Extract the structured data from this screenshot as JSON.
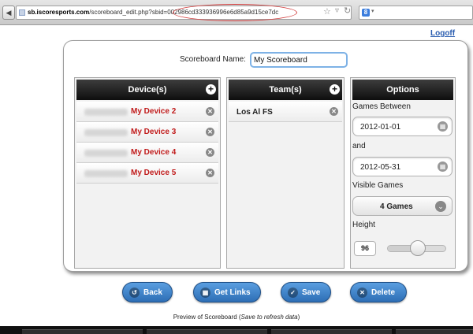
{
  "browser": {
    "url_domain": "sb.iscoresports.com",
    "url_path": "/scoreboard_edit.php?sbid=",
    "url_sbid": "002986cd333936996e6d85a9d15ce7dc",
    "search_engine_letter": "8"
  },
  "header": {
    "logoff_label": "Logoff"
  },
  "scoreboard": {
    "name_label": "Scoreboard Name:",
    "name_value": "My Scoreboard"
  },
  "devices": {
    "title": "Device(s)",
    "items": [
      {
        "label": "My Device 2"
      },
      {
        "label": "My Device 3"
      },
      {
        "label": "My Device 4"
      },
      {
        "label": "My Device 5"
      }
    ]
  },
  "teams": {
    "title": "Team(s)",
    "items": [
      {
        "label": "Los Al FS"
      }
    ]
  },
  "options": {
    "title": "Options",
    "games_between_label": "Games Between",
    "start_date": "2012-01-01",
    "and_label": "and",
    "end_date": "2012-05-31",
    "visible_games_label": "Visible Games",
    "visible_games_value": "4 Games",
    "height_label": "Height",
    "height_value": "96",
    "height_level_fraction": 0.52
  },
  "actions": {
    "back_label": "Back",
    "get_links_label": "Get Links",
    "save_label": "Save",
    "delete_label": "Delete"
  },
  "preview": {
    "caption_prefix": "Preview of Scoreboard (",
    "caption_italic": "Save to refresh data",
    "caption_suffix": ")"
  }
}
